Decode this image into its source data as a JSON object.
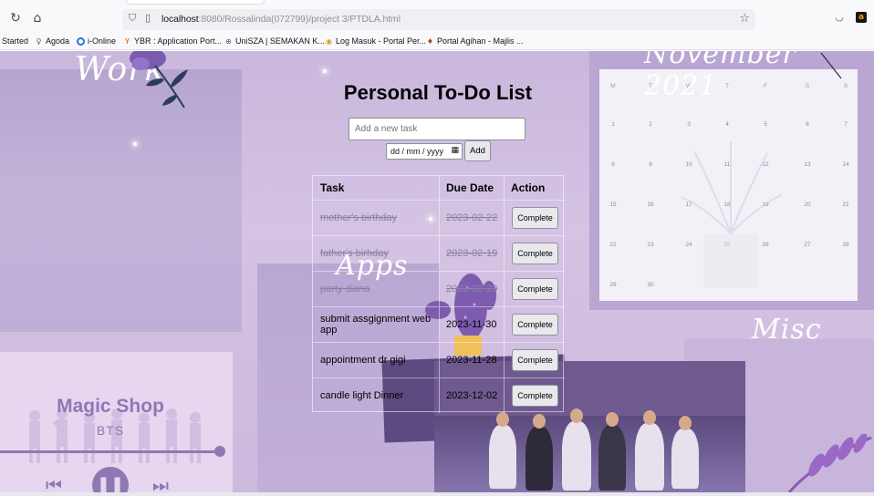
{
  "browser": {
    "url_host": "localhost",
    "url_path": ":8080/Rossalinda(072799)/project 3/PTDLA.html",
    "bookmarks": [
      {
        "label": "Started",
        "color": ""
      },
      {
        "label": "Agoda",
        "color": "#5c5c66"
      },
      {
        "label": "i-Online",
        "color": "#2f6fde"
      },
      {
        "label": "YBR : Application Port...",
        "color": "#e8742c"
      },
      {
        "label": "UniSZA | SEMAKAN K...",
        "color": "#5c5c66"
      },
      {
        "label": "Log Masuk - Portal Per...",
        "color": "#d69b26"
      },
      {
        "label": "Portal Agihan - Majlis ...",
        "color": "#b3421f"
      }
    ]
  },
  "background": {
    "work_label": "Work",
    "apps_label": "Apps",
    "misc_label": "Misc",
    "calendar_label": "November 2021",
    "music": {
      "title": "Magic Shop",
      "artist": "BTS"
    },
    "calendar": {
      "weekdays": [
        "M",
        "T",
        "W",
        "T",
        "F",
        "S",
        "S"
      ],
      "weeks": [
        [
          "1",
          "2",
          "3",
          "4",
          "5",
          "6",
          "7"
        ],
        [
          "8",
          "9",
          "10",
          "11",
          "12",
          "13",
          "14"
        ],
        [
          "15",
          "16",
          "17",
          "18",
          "19",
          "20",
          "21"
        ],
        [
          "22",
          "23",
          "24",
          "25",
          "26",
          "27",
          "28"
        ],
        [
          "29",
          "30",
          "",
          "",
          "",
          "",
          ""
        ]
      ]
    }
  },
  "todo": {
    "title": "Personal To-Do List",
    "input_placeholder": "Add a new task",
    "date_value": "dd / mm / yyyy",
    "add_label": "Add",
    "headers": {
      "task": "Task",
      "due": "Due Date",
      "action": "Action"
    },
    "tasks": [
      {
        "task": "mother's birthday",
        "due": "2023-02-22",
        "action": "Complete",
        "done": true
      },
      {
        "task": "father's birhday",
        "due": "2023-02-19",
        "action": "Complete",
        "done": true
      },
      {
        "task": "party diana",
        "due": "2023-02-20",
        "action": "Complete",
        "done": true
      },
      {
        "task": "submit assgignment web app",
        "due": "2023-11-30",
        "action": "Complete",
        "done": false
      },
      {
        "task": "appointment dr gigi",
        "due": "2023-11-28",
        "action": "Complete",
        "done": false
      },
      {
        "task": "candle light Dinner",
        "due": "2023-12-02",
        "action": "Complete",
        "done": false
      }
    ]
  }
}
